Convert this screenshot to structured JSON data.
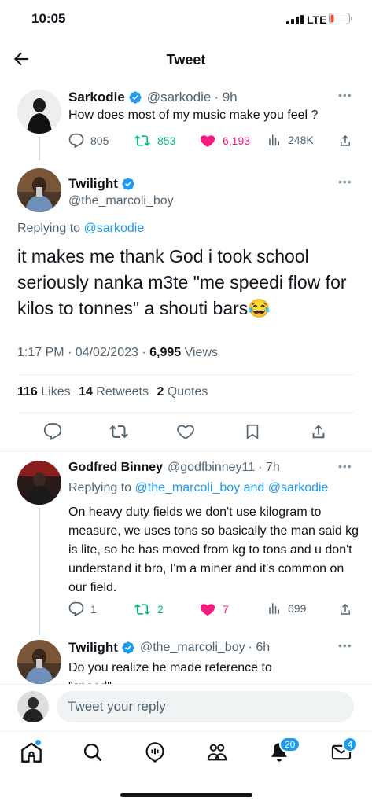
{
  "status_bar": {
    "time": "10:05",
    "network": "LTE"
  },
  "header": {
    "title": "Tweet"
  },
  "parent_tweet": {
    "name": "Sarkodie",
    "handle": "@sarkodie",
    "time": "· 9h",
    "text": "How does most of my music make you feel ?",
    "replies": "805",
    "retweets": "853",
    "likes": "6,193",
    "views": "248K"
  },
  "main_tweet": {
    "name": "Twilight",
    "handle": "@the_marcoli_boy",
    "replying_prefix": "Replying to ",
    "replying_to": "@sarkodie",
    "text": "it makes me thank God i took school seriously nanka m3te \"me speedi flow for kilos to tonnes\" a shouti bars😂",
    "timestamp": "1:17 PM · 04/02/2023 · ",
    "views_count": "6,995",
    "views_label": " Views",
    "likes_count": "116",
    "likes_label": " Likes",
    "retweets_count": "14",
    "retweets_label": " Retweets",
    "quotes_count": "2",
    "quotes_label": " Quotes"
  },
  "reply_1": {
    "name": "Godfred Binney",
    "handle": "@godfbinney11",
    "time": "· 7h",
    "replying_prefix": "Replying to ",
    "replying_to": "@the_marcoli_boy and @sarkodie",
    "text": "On heavy duty fields we don't use kilogram to measure, we uses tons so basically the man said kg is lite, so he has moved from kg to tons and u don't understand it bro, I'm a miner and it's common on our field.",
    "replies": "1",
    "retweets": "2",
    "likes": "7",
    "views": "699"
  },
  "reply_2": {
    "name": "Twilight",
    "handle": "@the_marcoli_boy",
    "time": "· 6h",
    "text": "Do you realize he made reference to \"speed\""
  },
  "composer": {
    "placeholder": "Tweet your reply"
  },
  "tab_bar": {
    "notifications_badge": "20",
    "messages_badge": "4"
  },
  "colors": {
    "accent": "#1d9bf0",
    "like": "#f91880",
    "retweet": "#00ba7c"
  },
  "icons": [
    "back-arrow-icon",
    "verified-icon",
    "reply-icon",
    "retweet-icon",
    "heart-icon",
    "views-icon",
    "share-icon",
    "bookmark-icon",
    "home-icon",
    "search-icon",
    "spaces-icon",
    "communities-icon",
    "bell-icon",
    "mail-icon"
  ]
}
